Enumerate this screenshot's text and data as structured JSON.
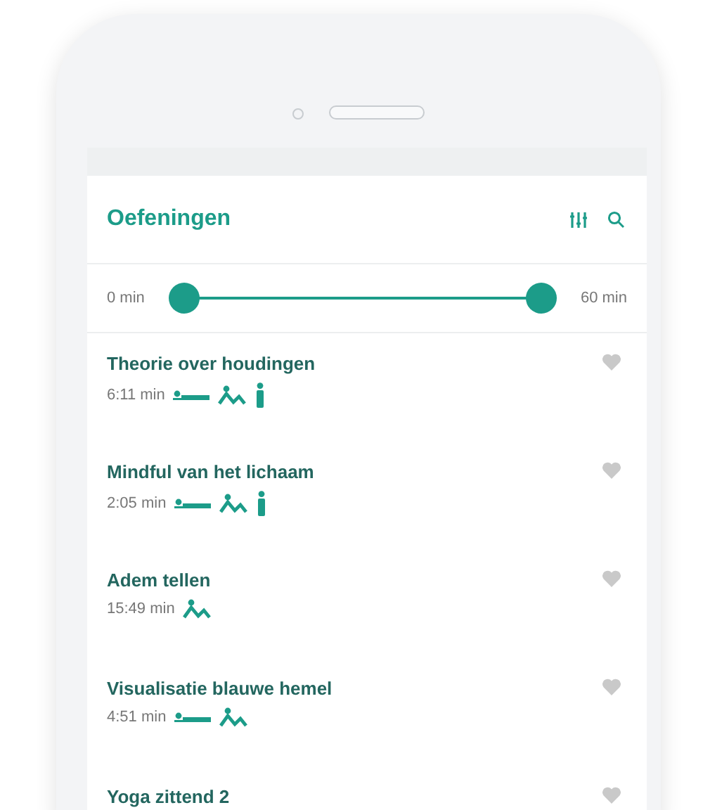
{
  "header": {
    "title": "Oefeningen"
  },
  "duration_filter": {
    "min_label": "0 min",
    "max_label": "60 min",
    "thumbs": [
      {
        "level": 0
      },
      {
        "level": 1
      }
    ]
  },
  "exercises": [
    {
      "title": "Theorie over houdingen",
      "duration": "6:11 min",
      "favorite": false,
      "postures": [
        {
          "kind": "lying"
        },
        {
          "kind": "reclining"
        },
        {
          "kind": "standing"
        }
      ]
    },
    {
      "title": "Mindful van het lichaam",
      "duration": "2:05 min",
      "favorite": false,
      "postures": [
        {
          "kind": "lying"
        },
        {
          "kind": "reclining"
        },
        {
          "kind": "standing"
        }
      ]
    },
    {
      "title": "Adem tellen",
      "duration": "15:49 min",
      "favorite": false,
      "postures": [
        {
          "kind": "reclining"
        }
      ]
    },
    {
      "title": "Visualisatie blauwe hemel",
      "duration": "4:51 min",
      "favorite": false,
      "postures": [
        {
          "kind": "lying"
        },
        {
          "kind": "reclining"
        }
      ]
    },
    {
      "title": "Yoga zittend 2",
      "favorite": false
    }
  ]
}
